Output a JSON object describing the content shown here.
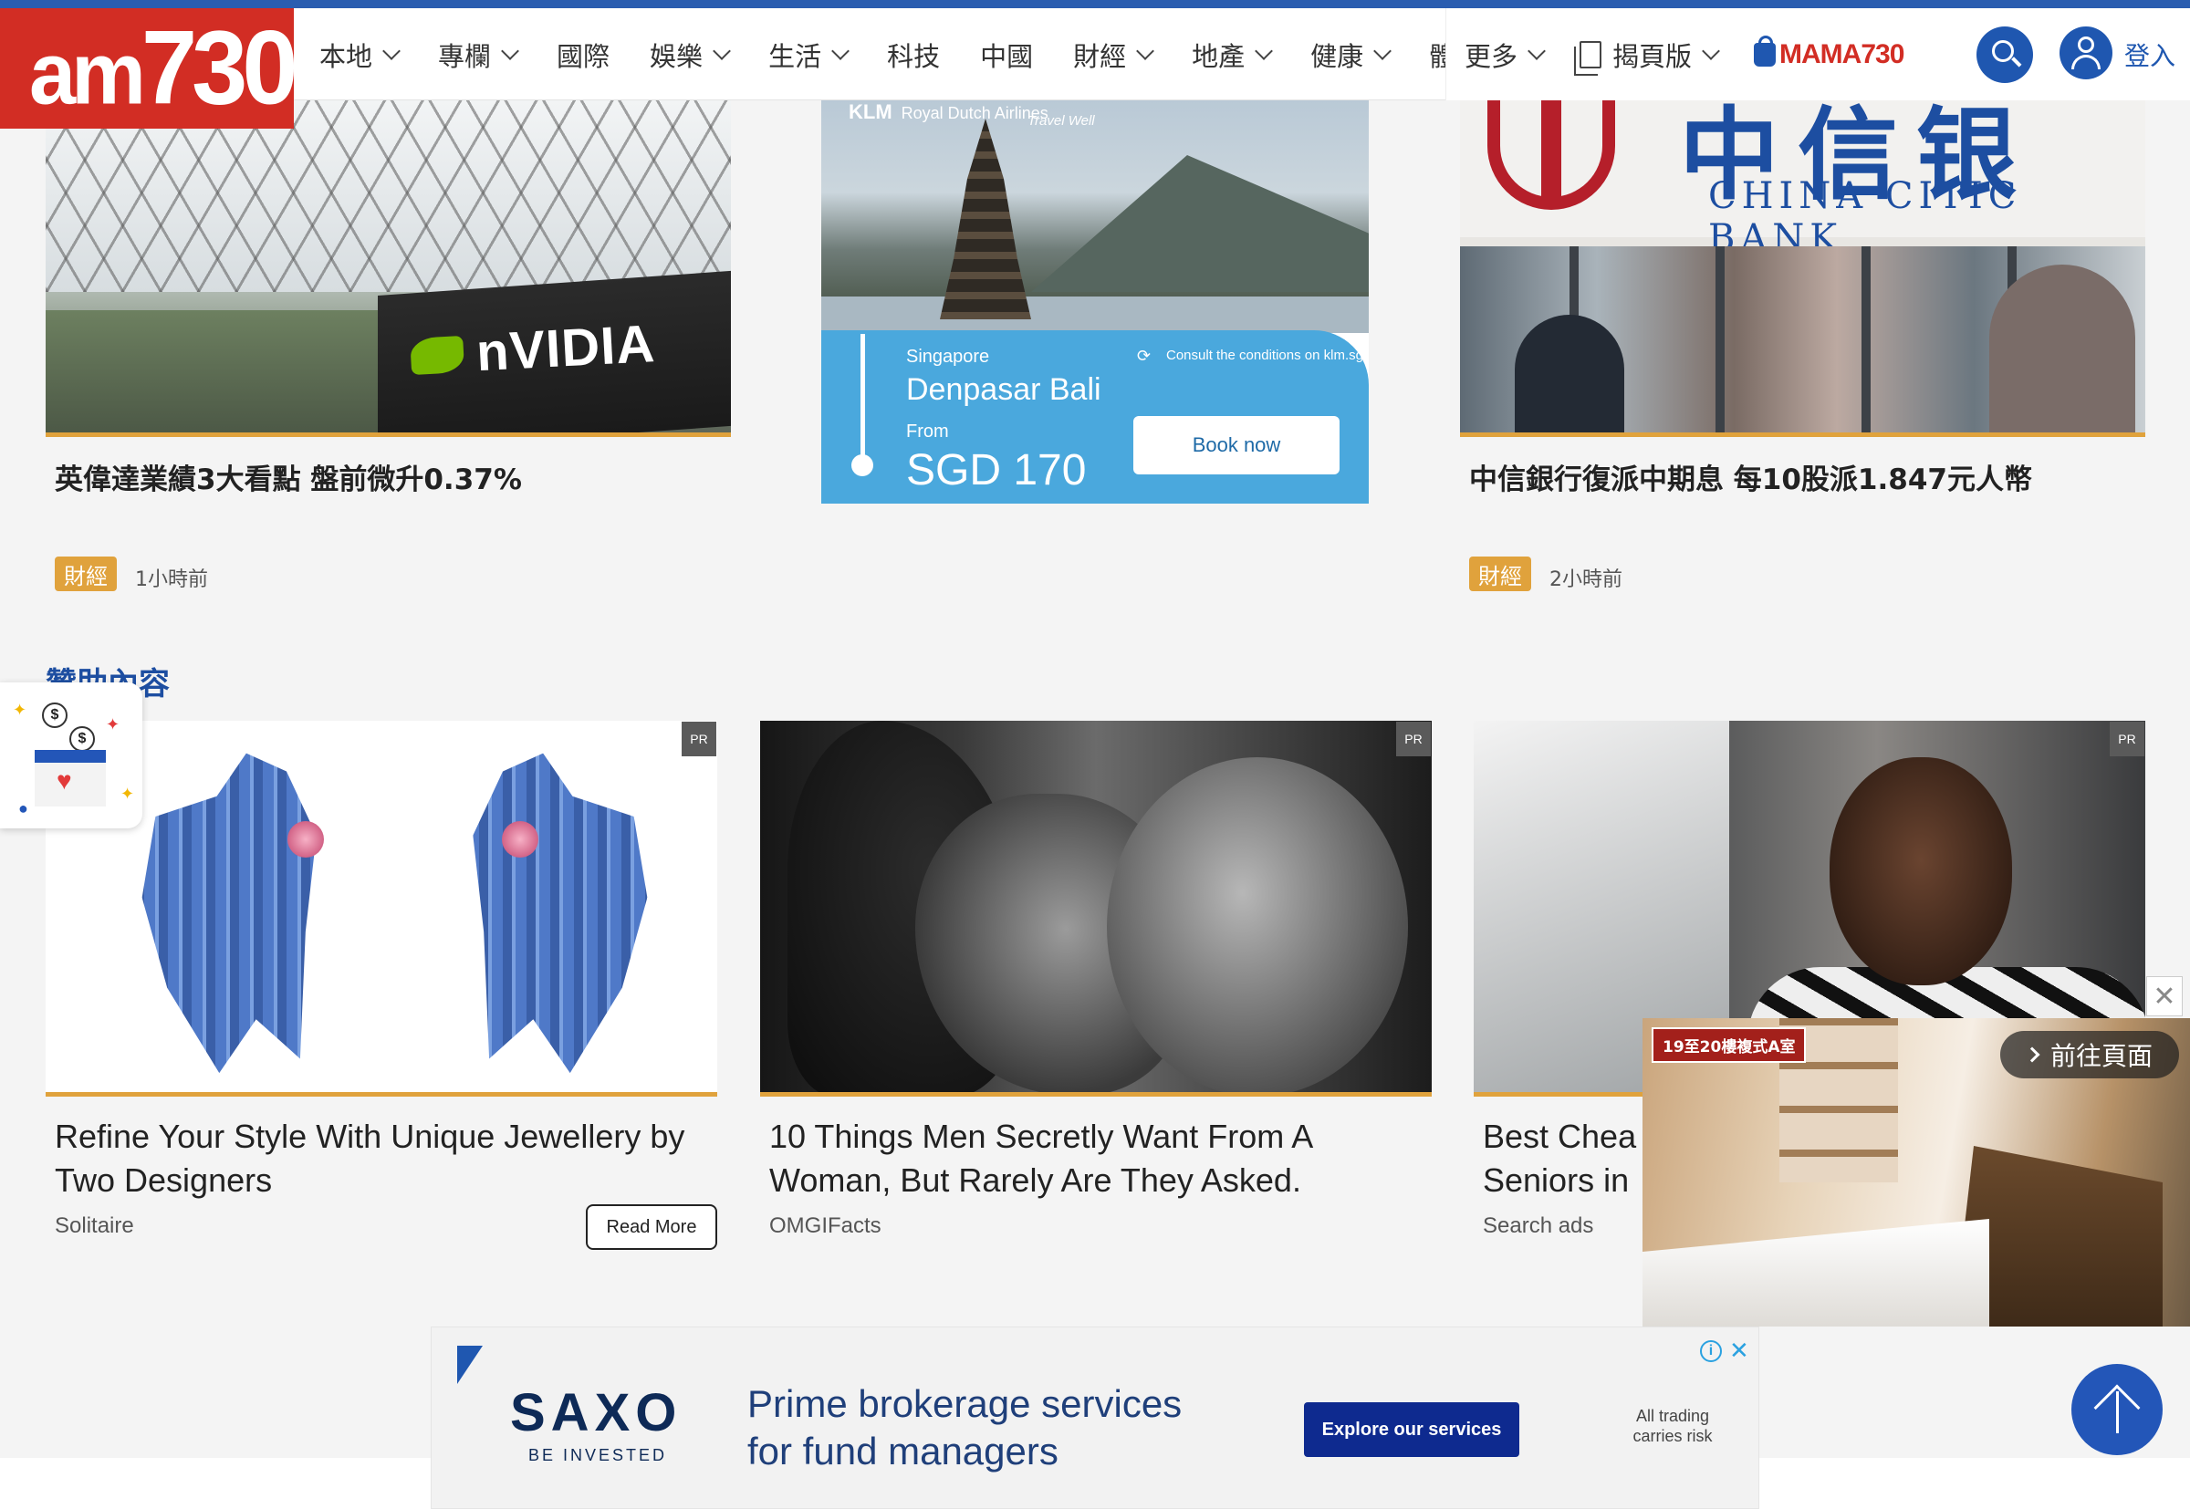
{
  "header": {
    "logo_text_am": "am",
    "logo_text_num": "730",
    "nav": [
      {
        "label": "本地"
      },
      {
        "label": "專欄"
      },
      {
        "label": "國際"
      },
      {
        "label": "娛樂"
      },
      {
        "label": "生活"
      },
      {
        "label": "科技"
      },
      {
        "label": "中國"
      },
      {
        "label": "財經"
      },
      {
        "label": "地產"
      },
      {
        "label": "健康"
      },
      {
        "label": "體"
      }
    ],
    "more_label": "更多",
    "epaper_label": "揭頁版",
    "mama_label": "MAMA730",
    "login_label": "登入"
  },
  "articles": [
    {
      "title": "英偉達業績3大看點 盤前微升0.37%",
      "tag": "財經",
      "time": "1小時前",
      "image_text": "nVIDIA"
    },
    {
      "title": "中信銀行復派中期息 每10股派1.847元人幣",
      "tag": "財經",
      "time": "2小時前",
      "image_text_zh": "中信银行",
      "image_text_en": "CHINA CITIC BANK"
    }
  ],
  "klm_ad": {
    "brand": "KLM",
    "brand_sub": "Royal Dutch Airlines",
    "tagline": "Travel Well",
    "from_city": "Singapore",
    "to_city": "Denpasar Bali",
    "from_label": "From",
    "price": "SGD 170",
    "conditions": "Consult the conditions on klm.sg",
    "button": "Book now"
  },
  "sponsored": {
    "heading": "贊助內容",
    "pr_label": "PR",
    "items": [
      {
        "title": "Refine Your Style With Unique Jewellery by Two Designers",
        "source": "Solitaire",
        "button": "Read More"
      },
      {
        "title": "10 Things Men Secretly Want From A Woman, But Rarely Are They Asked.",
        "source": "OMGIFacts"
      },
      {
        "title": "Best Chea",
        "title_line2": "Seniors in",
        "source": "Search ads"
      }
    ]
  },
  "video": {
    "label": "19至20樓複式A室",
    "goto": "前往頁面",
    "close": "✕"
  },
  "saxo_ad": {
    "logo": "SAXO",
    "sub": "BE INVESTED",
    "headline_1": "Prime brokerage services",
    "headline_2": "for fund managers",
    "button": "Explore our services",
    "risk": "All trading carries risk",
    "info": "i",
    "close": "✕"
  },
  "colors": {
    "brand_red": "#d22d24",
    "brand_blue": "#1f57b0",
    "tag_orange": "#e0a23c",
    "klm_blue": "#4aa8dd"
  }
}
